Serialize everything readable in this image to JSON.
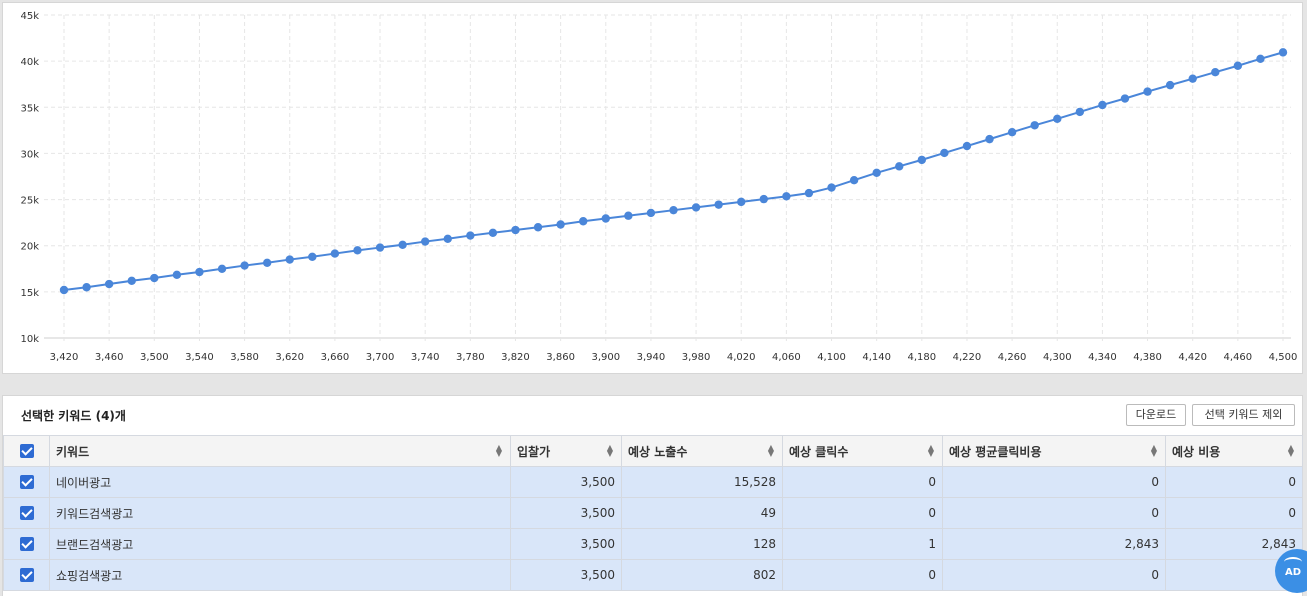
{
  "chart_data": {
    "type": "line",
    "x": [
      3420,
      3440,
      3460,
      3480,
      3500,
      3520,
      3540,
      3560,
      3580,
      3600,
      3620,
      3640,
      3660,
      3680,
      3700,
      3720,
      3740,
      3760,
      3780,
      3800,
      3820,
      3840,
      3860,
      3880,
      3900,
      3920,
      3940,
      3960,
      3980,
      4000,
      4020,
      4040,
      4060,
      4080,
      4100,
      4120,
      4140,
      4160,
      4180,
      4200,
      4220,
      4240,
      4260,
      4280,
      4300,
      4320,
      4340,
      4360,
      4380,
      4400,
      4420,
      4440,
      4460,
      4480,
      4500
    ],
    "series": [
      {
        "color": "#4a86d9",
        "values": [
          15200,
          15500,
          15850,
          16200,
          16500,
          16850,
          17150,
          17500,
          17850,
          18150,
          18500,
          18800,
          19150,
          19500,
          19800,
          20100,
          20450,
          20750,
          21100,
          21400,
          21700,
          22000,
          22300,
          22650,
          22950,
          23250,
          23550,
          23850,
          24150,
          24450,
          24750,
          25050,
          25350,
          25700,
          26300,
          27100,
          27900,
          28600,
          29300,
          30050,
          30800,
          31550,
          32300,
          33050,
          33750,
          34500,
          35250,
          35950,
          36700,
          37400,
          38100,
          38800,
          39500,
          40250,
          40950
        ]
      }
    ],
    "x_tick_labels": [
      "3,420",
      "3,460",
      "3,500",
      "3,540",
      "3,580",
      "3,620",
      "3,660",
      "3,700",
      "3,740",
      "3,780",
      "3,820",
      "3,860",
      "3,900",
      "3,940",
      "3,980",
      "4,020",
      "4,060",
      "4,100",
      "4,140",
      "4,180",
      "4,220",
      "4,260",
      "4,300",
      "4,340",
      "4,380",
      "4,420",
      "4,460",
      "4,500"
    ],
    "x_ticks": [
      3420,
      3460,
      3500,
      3540,
      3580,
      3620,
      3660,
      3700,
      3740,
      3780,
      3820,
      3860,
      3900,
      3940,
      3980,
      4020,
      4060,
      4100,
      4140,
      4180,
      4220,
      4260,
      4300,
      4340,
      4380,
      4420,
      4460,
      4500
    ],
    "y_tick_labels": [
      "10k",
      "15k",
      "20k",
      "25k",
      "30k",
      "35k",
      "40k",
      "45k"
    ],
    "y_ticks": [
      10000,
      15000,
      20000,
      25000,
      30000,
      35000,
      40000,
      45000
    ],
    "xlim": [
      3420,
      4500
    ],
    "ylim": [
      10000,
      45000
    ],
    "grid": true,
    "title": "",
    "xlabel": "",
    "ylabel": ""
  },
  "keywords_panel": {
    "title": "선택한 키워드 (4)개",
    "download_label": "다운로드",
    "exclude_label": "선택 키워드 제외",
    "columns": [
      "키워드",
      "입찰가",
      "예상 노출수",
      "예상 클릭수",
      "예상 평균클릭비용",
      "예상 비용"
    ],
    "rows": [
      {
        "keyword": "네이버광고",
        "bid": "3,500",
        "impressions": "15,528",
        "clicks": "0",
        "avg_cpc": "0",
        "cost": "0"
      },
      {
        "keyword": "키워드검색광고",
        "bid": "3,500",
        "impressions": "49",
        "clicks": "0",
        "avg_cpc": "0",
        "cost": "0"
      },
      {
        "keyword": "브랜드검색광고",
        "bid": "3,500",
        "impressions": "128",
        "clicks": "1",
        "avg_cpc": "2,843",
        "cost": "2,843"
      },
      {
        "keyword": "쇼핑검색광고",
        "bid": "3,500",
        "impressions": "802",
        "clicks": "0",
        "avg_cpc": "0",
        "cost": ""
      }
    ]
  },
  "ad_badge": {
    "label": "AD"
  },
  "colors": {
    "accent": "#2e6bd3",
    "row_selected": "#d9e6f9",
    "line": "#4a86d9"
  }
}
